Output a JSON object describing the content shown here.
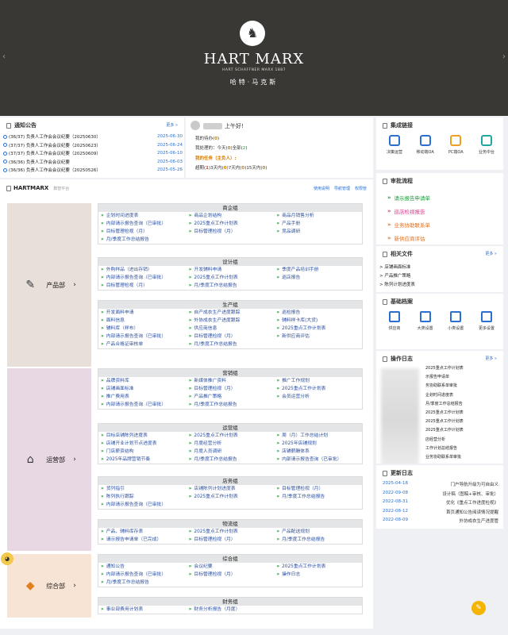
{
  "header": {
    "brand": "HART MARX",
    "brand_sub": "HART SCHAFFNER MARX 1887",
    "brand_cn": "哈特·马克斯"
  },
  "notices": {
    "title": "通知公告",
    "more": "更多 »",
    "items": [
      {
        "text": "(36/37) 负责人工作会会议纪要（20250630）",
        "date": "2025-06-30"
      },
      {
        "text": "(37/37) 负责人工作会会议纪要（20250623）",
        "date": "2025-06-24"
      },
      {
        "text": "(37/37) 负责人工作会会议纪要（20250609）",
        "date": "2025-06-10"
      },
      {
        "text": "(36/36) 负责人工作会会议纪要",
        "date": "2025-06-03"
      },
      {
        "text": "(36/36) 负责人工作会会议纪要（20250526）",
        "date": "2025-05-26"
      }
    ]
  },
  "greeting": {
    "hello": "上午好!",
    "todo_label": "我的待办(",
    "todo_val": "0",
    "close": ")",
    "done_label": "我处理的：今天(",
    "today": "0",
    "all_label": ")全部(",
    "all": "2",
    "warn_label": "我的任务（主负人）:",
    "overdue_label": "超期(",
    "overdue": "1",
    "d3_label": ")3天内(",
    "d3": "0",
    "d7_label": ")7天内(",
    "d7": "0",
    "d15_label": ")15天内(",
    "d15": "0"
  },
  "integrations": {
    "title": "集成链接",
    "items": [
      {
        "label": "决策运营",
        "icon": "chart-icon"
      },
      {
        "label": "移动端OA",
        "icon": "home-icon"
      },
      {
        "label": "PC端OA",
        "icon": "printer-icon"
      },
      {
        "label": "业务中台",
        "icon": "screen-icon"
      }
    ]
  },
  "approval": {
    "title": "审批流程",
    "items": [
      "请示报告申请单",
      "巡店检视报告",
      "业务协助联系单",
      "新供应商评估"
    ]
  },
  "files": {
    "title": "相关文件",
    "more": "更多 »",
    "items": [
      "店铺画面标准",
      "产品推广策略",
      "陈列计划进度表"
    ]
  },
  "basic": {
    "title": "基础档案",
    "items": [
      "供应商",
      "大类设置",
      "小类设置",
      "更多设置"
    ]
  },
  "oplog": {
    "title": "操作日志",
    "more": "更多 »",
    "items": [
      "2025重点工作计划表",
      "示报告申请单",
      "务协助联系单审批",
      "企划时间进度表",
      "月/季度工作总结报告",
      "2025重点工作计划表",
      "2025重点工作计划表",
      "2025重点工作计划表",
      "店经营分析",
      "工作计划总结报告",
      "业务协助联系单审批"
    ]
  },
  "updates": {
    "title": "更新日志",
    "items": [
      {
        "date": "2025-04-18",
        "text": "门户导航升级为可自由义"
      },
      {
        "date": "2022-09-08",
        "text": "设计稿（图稿+审核、审批）"
      },
      {
        "date": "2022-08-31",
        "text": "优化《重点工作进度检视》"
      },
      {
        "date": "2022-08-12",
        "text": "首页通知公告阅读情况提醒"
      },
      {
        "date": "2022-08-09",
        "text": "外协成衣生产进度管"
      }
    ]
  },
  "system": {
    "title": "HARTMARX",
    "subtitle": "数智平台",
    "links": [
      "使用说明",
      "导航管理",
      "权限管"
    ]
  },
  "depts": [
    {
      "label": "产品部",
      "icon": "edit-icon",
      "color": "#e8e0d8"
    },
    {
      "label": "运营部",
      "icon": "store-icon",
      "color": "#e8d8e4"
    },
    {
      "label": "综合部",
      "icon": "shield-icon",
      "color": "#f8e4d4"
    }
  ],
  "sections": [
    {
      "name": "商企组",
      "links": [
        "企划时间进度表",
        "商品企划结构",
        "商品月销售分析",
        "内部请示报告查询（已审批）",
        "2025重点工作计划表",
        "产品手册",
        "目标管理检视（月）",
        "目标管理检视（月）",
        "竞品调研",
        "月/季度工作总结报告"
      ]
    },
    {
      "name": "设计组",
      "links": [
        "外购样品（进出存销）",
        "开发辅料申请",
        "季度产品培训手册",
        "内部请示报告查询（已审批）",
        "2025重点工作计划表",
        "巡店报告",
        "目标管理检视（月）",
        "月/季度工作总结报告"
      ]
    },
    {
      "name": "生产组",
      "links": [
        "开发面料申请",
        "自产成衣生产进度跟踪",
        "巡检报告",
        "面料信息",
        "外协成衣生产进度跟踪",
        "辅料样卡库(大货)",
        "辅料库（样布）",
        "供应商信息",
        "2025重点工作计划表",
        "内部请示报告查询（已审批）",
        "目标管理检视（月）",
        "新供应商评估",
        "产品合格证审核单",
        "月/季度工作总结报告"
      ]
    },
    {
      "name": "营销组",
      "links": [
        "品牌资料库",
        "新媒体推广资料",
        "推广工作规划",
        "店铺画面标准",
        "目标管理检视（月）",
        "2025重点工作计划表",
        "推广费用表",
        "产品推广策略",
        "会员运营分析",
        "内部请示报告查询（已审批）",
        "月/季度工作总结报告"
      ]
    },
    {
      "name": "运营组",
      "links": [
        "目标店铺陈列进度表",
        "2025重点工作计划表",
        "周（月）工作总结计划",
        "店铺开业计划节点进度表",
        "月度经营分析",
        "2025年店铺规划",
        "门店薪资结构",
        "月度人员调研",
        "店铺薪酬体系",
        "2025年品牌营销节奏",
        "月/季度工作总结报告",
        "内部请示报告查询（已审批）"
      ]
    },
    {
      "name": "店务组",
      "links": [
        "货列指引",
        "店铺陈列计划进度表",
        "目标管理检视（月）",
        "陈列执行跟踪",
        "2025重点工作计划表",
        "月/季度工作总结报告",
        "内部请示报告查询（已审批）"
      ]
    },
    {
      "name": "物流组",
      "links": [
        "产品、辅料库存表",
        "2025重点工作计划表",
        "产品配送规划",
        "请示报告申请单（已完成）",
        "目标管理检视（月）",
        "月/季度工作总结报告"
      ]
    },
    {
      "name": "综合组",
      "links": [
        "通知公告",
        "会议纪要",
        "2025重点工作计划表",
        "内部请示报告查询（已审批）",
        "目标管理检视（月）",
        "操作日志",
        "月/季度工作总结报告"
      ]
    },
    {
      "name": "财务组",
      "links": [
        "事业部费用计划表",
        "财务分析报告（月度）"
      ]
    }
  ]
}
